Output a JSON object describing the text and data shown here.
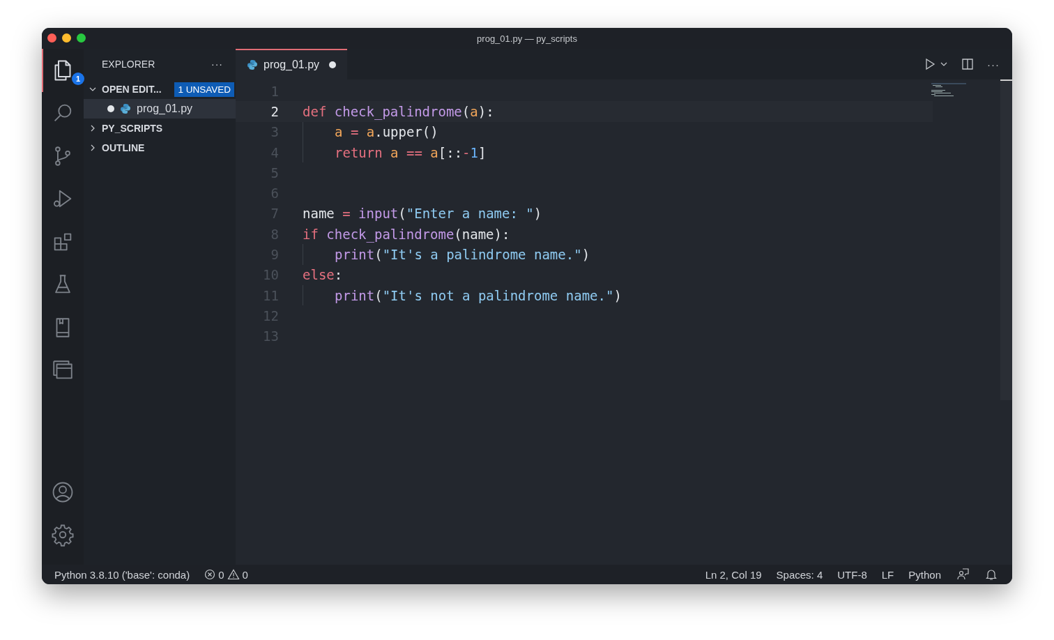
{
  "window": {
    "title": "prog_01.py — py_scripts"
  },
  "activity_bar": {
    "items": [
      {
        "selected": true,
        "badge": "1"
      },
      {
        "selected": false
      },
      {
        "selected": false
      },
      {
        "selected": false
      },
      {
        "selected": false
      },
      {
        "selected": false
      },
      {
        "selected": false
      },
      {
        "selected": false
      }
    ]
  },
  "sidebar": {
    "title": "EXPLORER",
    "more": "···",
    "sections": [
      {
        "label": "OPEN EDIT...",
        "expanded": true,
        "badge": "1 UNSAVED",
        "files": [
          {
            "name": "prog_01.py",
            "modified": true,
            "selected": true
          }
        ]
      },
      {
        "label": "PY_SCRIPTS",
        "expanded": false
      },
      {
        "label": "OUTLINE",
        "expanded": false
      }
    ]
  },
  "tabs": [
    {
      "label": "prog_01.py",
      "selected": true,
      "modified": true
    }
  ],
  "editor": {
    "more": "···",
    "lines": [
      {
        "number": "1",
        "current": false
      },
      {
        "number": "2",
        "current": true,
        "indented": false,
        "tokens": [
          {
            "text": "def ",
            "kind": "keyword"
          },
          {
            "text": "check_palindrome",
            "kind": "function"
          },
          {
            "text": "(",
            "kind": "plain"
          },
          {
            "text": "a",
            "kind": "param"
          },
          {
            "text": "):",
            "kind": "plain"
          }
        ]
      },
      {
        "number": "3",
        "current": false,
        "indented": true,
        "tokens": [
          {
            "text": "a",
            "kind": "param"
          },
          {
            "text": " = ",
            "kind": "operator"
          },
          {
            "text": "a",
            "kind": "param"
          },
          {
            "text": ".upper()",
            "kind": "plain"
          }
        ]
      },
      {
        "number": "4",
        "current": false,
        "indented": true,
        "tokens": [
          {
            "text": "return ",
            "kind": "keyword"
          },
          {
            "text": "a",
            "kind": "param"
          },
          {
            "text": " == ",
            "kind": "operator"
          },
          {
            "text": "a",
            "kind": "param"
          },
          {
            "text": "[::",
            "kind": "plain"
          },
          {
            "text": "-",
            "kind": "operator"
          },
          {
            "text": "1",
            "kind": "number"
          },
          {
            "text": "]",
            "kind": "plain"
          }
        ]
      },
      {
        "number": "5",
        "current": false
      },
      {
        "number": "6",
        "current": false
      },
      {
        "number": "7",
        "current": false,
        "indented": false,
        "tokens": [
          {
            "text": "name",
            "kind": "plain"
          },
          {
            "text": " = ",
            "kind": "operator"
          },
          {
            "text": "input",
            "kind": "function"
          },
          {
            "text": "(",
            "kind": "plain"
          },
          {
            "text": "\"Enter a name: \"",
            "kind": "string"
          },
          {
            "text": ")",
            "kind": "plain"
          }
        ]
      },
      {
        "number": "8",
        "current": false,
        "indented": false,
        "tokens": [
          {
            "text": "if ",
            "kind": "keyword"
          },
          {
            "text": "check_palindrome",
            "kind": "function"
          },
          {
            "text": "(name):",
            "kind": "plain"
          }
        ]
      },
      {
        "number": "9",
        "current": false,
        "indented": true,
        "tokens": [
          {
            "text": "print",
            "kind": "function"
          },
          {
            "text": "(",
            "kind": "plain"
          },
          {
            "text": "\"It's a palindrome name.\"",
            "kind": "string"
          },
          {
            "text": ")",
            "kind": "plain"
          }
        ]
      },
      {
        "number": "10",
        "current": false,
        "indented": false,
        "tokens": [
          {
            "text": "else",
            "kind": "keyword"
          },
          {
            "text": ":",
            "kind": "plain"
          }
        ]
      },
      {
        "number": "11",
        "current": false,
        "indented": true,
        "tokens": [
          {
            "text": "print",
            "kind": "function"
          },
          {
            "text": "(",
            "kind": "plain"
          },
          {
            "text": "\"It's not a palindrome name.\"",
            "kind": "string"
          },
          {
            "text": ")",
            "kind": "plain"
          }
        ]
      },
      {
        "number": "12",
        "current": false
      },
      {
        "number": "13",
        "current": false
      }
    ]
  },
  "status_bar": {
    "interpreter": "Python 3.8.10 ('base': conda)",
    "errors": "0",
    "warnings": "0",
    "items": [
      "Ln 2, Col 19",
      "Spaces: 4",
      "UTF-8",
      "LF",
      "Python"
    ]
  }
}
